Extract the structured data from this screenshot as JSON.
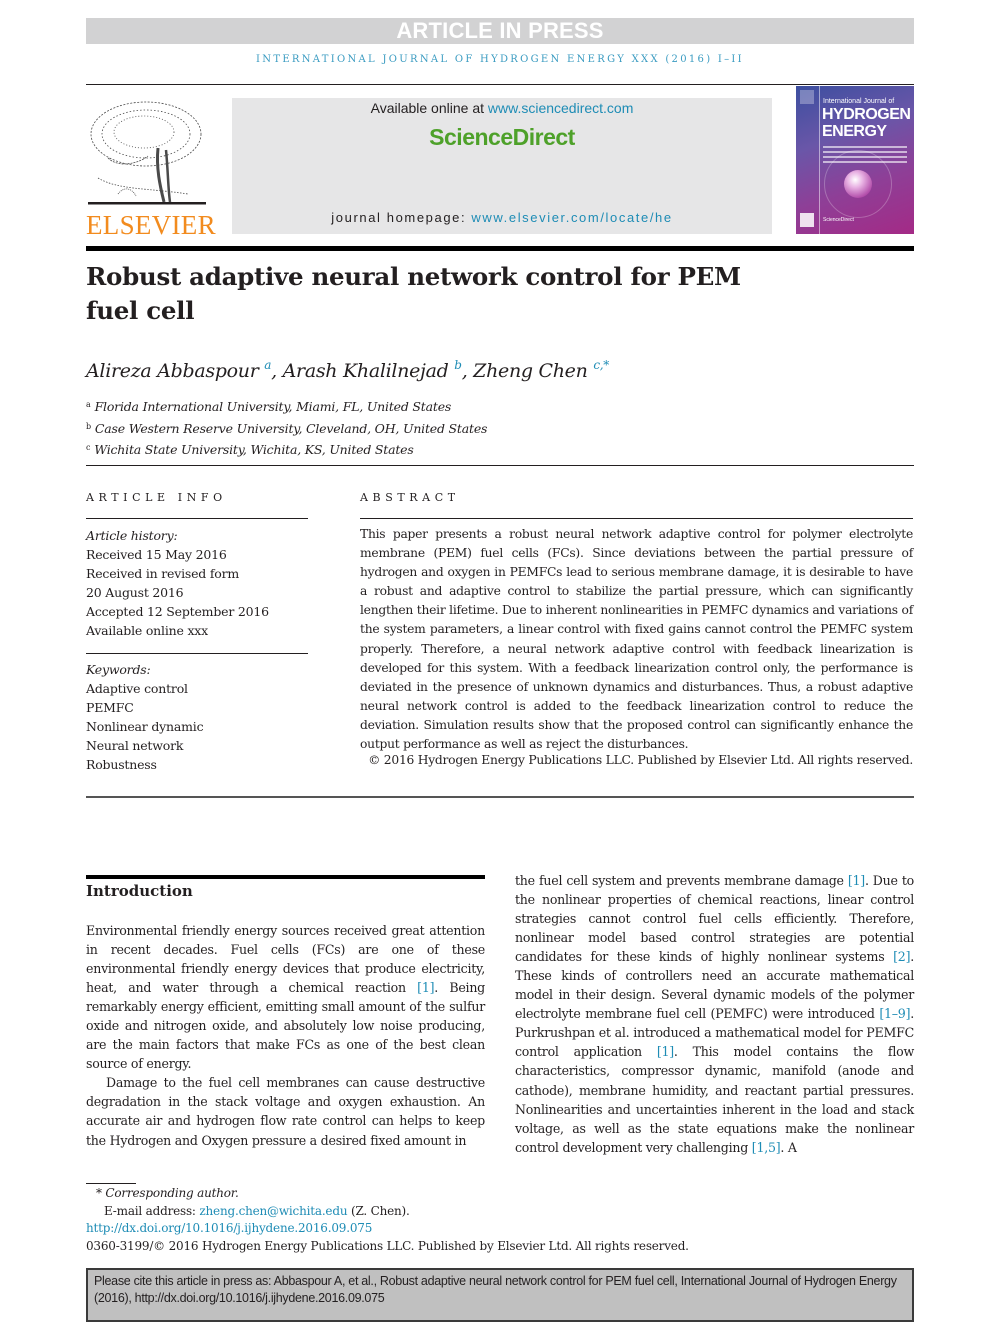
{
  "banner": {
    "text": "ARTICLE IN PRESS"
  },
  "running_head": "INTERNATIONAL JOURNAL OF HYDROGEN ENERGY XXX (2016) I–II",
  "publisher": {
    "logo_text": "ELSEVIER",
    "brand_color": "#f28b1e"
  },
  "sciencedirect": {
    "available_prefix": "Available online at ",
    "available_link": "www.sciencedirect.com",
    "logo_text": "ScienceDirect",
    "homepage_prefix": "journal homepage: ",
    "homepage_link": "www.elsevier.com/locate/he"
  },
  "cover": {
    "title_small": "International Journal of",
    "title_large_1": "HYDROGEN",
    "title_large_2": "ENERGY",
    "footer": "ScienceDirect"
  },
  "article": {
    "title_line1": "Robust adaptive neural network control for PEM",
    "title_line2": "fuel cell",
    "authors": [
      {
        "name": "Alireza Abbaspour",
        "sup": "a"
      },
      {
        "name": "Arash Khalilnejad",
        "sup": "b"
      },
      {
        "name": "Zheng Chen",
        "sup": "c,*"
      }
    ],
    "affiliations": [
      {
        "key": "a",
        "text": "Florida International University, Miami, FL, United States"
      },
      {
        "key": "b",
        "text": "Case Western Reserve University, Cleveland, OH, United States"
      },
      {
        "key": "c",
        "text": "Wichita State University, Wichita, KS, United States"
      }
    ]
  },
  "article_info": {
    "heading": "ARTICLE INFO",
    "history_label": "Article history:",
    "history": [
      "Received 15 May 2016",
      "Received in revised form",
      "20 August 2016",
      "Accepted 12 September 2016",
      "Available online xxx"
    ],
    "keywords_label": "Keywords:",
    "keywords": [
      "Adaptive control",
      "PEMFC",
      "Nonlinear dynamic",
      "Neural network",
      "Robustness"
    ]
  },
  "abstract": {
    "heading": "ABSTRACT",
    "text": "This paper presents a robust neural network adaptive control for polymer electrolyte membrane (PEM) fuel cells (FCs). Since deviations between the partial pressure of hydrogen and oxygen in PEMFCs lead to serious membrane damage, it is desirable to have a robust and adaptive control to stabilize the partial pressure, which can significantly lengthen their lifetime. Due to inherent nonlinearities in PEMFC dynamics and variations of the system parameters, a linear control with fixed gains cannot control the PEMFC system properly. Therefore, a neural network adaptive control with feedback linearization is developed for this system. With a feedback linearization control only, the performance is deviated in the presence of unknown dynamics and disturbances. Thus, a robust adaptive neural network control is added to the feedback linearization control to reduce the deviation. Simulation results show that the proposed control can significantly enhance the output performance as well as reject the disturbances.",
    "copyright": "© 2016 Hydrogen Energy Publications LLC. Published by Elsevier Ltd. All rights reserved."
  },
  "introduction": {
    "heading": "Introduction",
    "left_p1_a": "Environmental friendly energy sources received great attention in recent decades. Fuel cells (FCs) are one of these environmental friendly energy devices that produce electricity, heat, and water through a chemical reaction ",
    "left_p1_ref": "[1]",
    "left_p1_b": ". Being remarkably energy efficient, emitting small amount of the sulfur oxide and nitrogen oxide, and absolutely low noise producing, are the main factors that make FCs as one of the best clean source of energy.",
    "left_p2": "Damage to the fuel cell membranes can cause destructive degradation in the stack voltage and oxygen exhaustion. An accurate air and hydrogen flow rate control can helps to keep the Hydrogen and Oxygen pressure a desired fixed amount in",
    "right_a": "the fuel cell system and prevents membrane damage ",
    "right_ref1": "[1]",
    "right_b": ". Due to the nonlinear properties of chemical reactions, linear control strategies cannot control fuel cells efficiently. Therefore, nonlinear model based control strategies are potential candidates for these kinds of highly nonlinear systems ",
    "right_ref2": "[2]",
    "right_c": ". These kinds of controllers need an accurate mathematical model in their design. Several dynamic models of the polymer electrolyte membrane fuel cell (PEMFC) were introduced ",
    "right_ref3": "[1–9]",
    "right_d": ". Purkrushpan et al. introduced a mathematical model for PEMFC control application ",
    "right_ref4": "[1]",
    "right_e": ". This model contains the flow characteristics, compressor dynamic, manifold (anode and cathode), membrane humidity, and reactant partial pressures. Nonlinearities and uncertainties inherent in the load and stack voltage, as well as the state equations make the nonlinear control development very challenging ",
    "right_ref5": "[1,5]",
    "right_f": ". A"
  },
  "footnotes": {
    "corresponding": "* Corresponding author.",
    "email_label": "E-mail address: ",
    "email": "zheng.chen@wichita.edu",
    "email_suffix": " (Z. Chen).",
    "doi": "http://dx.doi.org/10.1016/j.ijhydene.2016.09.075",
    "issn_copyright": "0360-3199/© 2016 Hydrogen Energy Publications LLC. Published by Elsevier Ltd. All rights reserved."
  },
  "citation_box": {
    "text": "Please cite this article in press as: Abbaspour A, et al., Robust adaptive neural network control for PEM fuel cell, International Journal of Hydrogen Energy (2016), http://dx.doi.org/10.1016/j.ijhydene.2016.09.075"
  },
  "colors": {
    "link": "#1e8cb5",
    "sciencedirect_green": "#4ea12a",
    "banner_gray": "#d2d2d3"
  }
}
